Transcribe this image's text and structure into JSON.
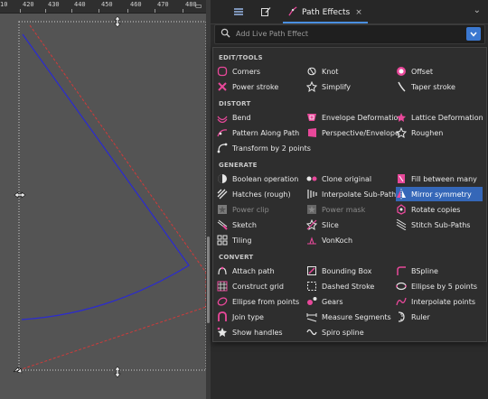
{
  "ruler": {
    "labels": [
      "10",
      "420",
      "430",
      "440",
      "450",
      "460",
      "470",
      "480"
    ]
  },
  "panel": {
    "tabs": [
      {
        "icon": "layers-icon"
      },
      {
        "icon": "edit-icon"
      },
      {
        "icon": "path-effects-icon",
        "label": "Path Effects",
        "close": "×",
        "active": true
      }
    ],
    "menu_glyph": "⌄"
  },
  "search": {
    "placeholder": "Add Live Path Effect"
  },
  "categories": [
    {
      "title": "EDIT/TOOLS",
      "items": [
        {
          "label": "Corners",
          "icon": "corners-icon"
        },
        {
          "label": "Knot",
          "icon": "knot-icon"
        },
        {
          "label": "Offset",
          "icon": "offset-icon"
        },
        {
          "label": "Power stroke",
          "icon": "power-stroke-icon"
        },
        {
          "label": "Simplify",
          "icon": "simplify-icon"
        },
        {
          "label": "Taper stroke",
          "icon": "taper-stroke-icon"
        }
      ]
    },
    {
      "title": "DISTORT",
      "items": [
        {
          "label": "Bend",
          "icon": "bend-icon"
        },
        {
          "label": "Envelope Deformation",
          "icon": "envelope-icon"
        },
        {
          "label": "Lattice Deformation",
          "icon": "lattice-icon"
        },
        {
          "label": "Pattern Along Path",
          "icon": "pattern-along-path-icon"
        },
        {
          "label": "Perspective/Envelope",
          "icon": "perspective-icon"
        },
        {
          "label": "Roughen",
          "icon": "roughen-icon"
        },
        {
          "label": "Transform by 2 points",
          "icon": "transform-2pts-icon"
        }
      ]
    },
    {
      "title": "GENERATE",
      "items": [
        {
          "label": "Boolean operation",
          "icon": "boolean-icon"
        },
        {
          "label": "Clone original",
          "icon": "clone-original-icon"
        },
        {
          "label": "Fill between many",
          "icon": "fill-between-icon"
        },
        {
          "label": "Hatches (rough)",
          "icon": "hatches-icon"
        },
        {
          "label": "Interpolate Sub-Paths",
          "icon": "interpolate-subpaths-icon"
        },
        {
          "label": "Mirror symmetry",
          "icon": "mirror-symmetry-icon",
          "selected": true
        },
        {
          "label": "Power clip",
          "icon": "power-clip-icon",
          "disabled": true
        },
        {
          "label": "Power mask",
          "icon": "power-mask-icon",
          "disabled": true
        },
        {
          "label": "Rotate copies",
          "icon": "rotate-copies-icon"
        },
        {
          "label": "Sketch",
          "icon": "sketch-icon"
        },
        {
          "label": "Slice",
          "icon": "slice-icon"
        },
        {
          "label": "Stitch Sub-Paths",
          "icon": "stitch-icon"
        },
        {
          "label": "Tiling",
          "icon": "tiling-icon"
        },
        {
          "label": "VonKoch",
          "icon": "vonkoch-icon"
        }
      ]
    },
    {
      "title": "CONVERT",
      "items": [
        {
          "label": "Attach path",
          "icon": "attach-path-icon"
        },
        {
          "label": "Bounding Box",
          "icon": "bounding-box-icon"
        },
        {
          "label": "BSpline",
          "icon": "bspline-icon"
        },
        {
          "label": "Construct grid",
          "icon": "construct-grid-icon"
        },
        {
          "label": "Dashed Stroke",
          "icon": "dashed-stroke-icon"
        },
        {
          "label": "Ellipse by 5 points",
          "icon": "ellipse-5pts-icon"
        },
        {
          "label": "Ellipse from points",
          "icon": "ellipse-from-points-icon"
        },
        {
          "label": "Gears",
          "icon": "gears-icon"
        },
        {
          "label": "Interpolate points",
          "icon": "interpolate-points-icon"
        },
        {
          "label": "Join type",
          "icon": "join-type-icon"
        },
        {
          "label": "Measure Segments",
          "icon": "measure-segments-icon"
        },
        {
          "label": "Ruler",
          "icon": "ruler-icon"
        },
        {
          "label": "Show handles",
          "icon": "show-handles-icon"
        },
        {
          "label": "Spiro spline",
          "icon": "spiro-spline-icon"
        }
      ]
    }
  ],
  "colors": {
    "accent": "#3567b8",
    "icon_pink": "#e8489a",
    "icon_light": "#e6e6e6",
    "path_blue": "#2b2bd0",
    "path_red": "#d03a3a"
  }
}
